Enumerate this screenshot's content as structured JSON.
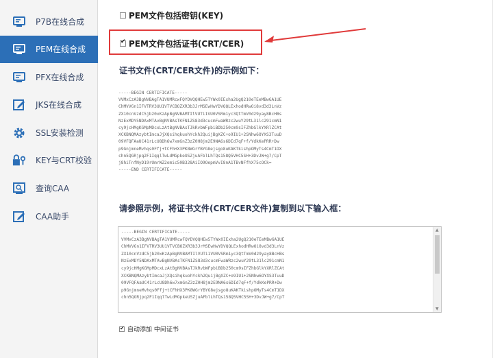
{
  "sidebar": {
    "items": [
      {
        "label": "P7B在线合成",
        "icon": "monitor-icon"
      },
      {
        "label": "PEM在线合成",
        "icon": "monitor-icon",
        "active": true
      },
      {
        "label": "PFX在线合成",
        "icon": "monitor-icon"
      },
      {
        "label": "JKS在线合成",
        "icon": "edit-icon"
      },
      {
        "label": "SSL安装检测",
        "icon": "gear-icon"
      },
      {
        "label": "KEY与CRT校验",
        "icon": "lock-icon"
      },
      {
        "label": "查询CAA",
        "icon": "search-icon"
      },
      {
        "label": "CAA助手",
        "icon": "edit-icon"
      }
    ]
  },
  "options": {
    "key_label": "PEM文件包括密钥(KEY)",
    "key_checked": false,
    "crt_label": "PEM文件包括证书(CRT/CER)",
    "crt_checked": true
  },
  "sample": {
    "title": "证书文件(CRT/CER文件)的示例如下：",
    "text": "-----BEGIN CERTIFICATE-----\nVVMxCzA3BgNVBAgTA1VUMRcwFQYDVQQHEw5TYWx0IExha2UgQ210eTEeMBwGA1UE\nChMVVGn1IFVTRV3UU1VTVCBOZXR3b3JrMSEwHwYDVQQLExhodHRwOi8vd3d3LnVz\nZX10cnVzdC5jb20xKzApBgNVBAMTIlVUTi1VU0VSRm1yc3QtTmV0d29yay8BcHBs\nNzExMDY5NDAxMTAvBgNVBAsTKFN1ZS83d3cucmFwaWRzc2wuY29tL31lc291cmN1\ncy9jcHMgKGMpMDcxLzAtBgNVBAsTJkRvbWFpbiBDb250cm9sIFZhbGlkYXRlZCAt\nXCKBNQMAzybtImcaJjXQsihqkuohYckh2QuijBgXZC+o9IU1+2SNhw6OYXS3TuuD\n09VFQFAaUC41rLcU8Dh6w7xmGnZ3zZ0H8jm2E9NA6s6DId7qF+f/YdkKePRR+Dw\np9GnjmneMvhqs0Ffj+tCFhHX3PK8WGrYBYG8ejsgo8uKAKTkishpOMyTs4CmT1DX\nchn5QGRjpq2F1IqqlTwLdMGpkeUSZjuAFblLhTQs158Q5VHC5SH+3DvJW+g7/CpT\nj8hiTnfNyD19rUmrWZ2omic50B328AiIO9OepmVvI8nA1TBvNFfhX75cOCk=\n-----END CERTIFICATE-----"
  },
  "input": {
    "title": "请参照示例，将证书文件(CRT/CER文件)复制到以下输入框：",
    "value": "-----BEGIN CERTIFICATE-----\nVVMxCzA3BgNVBAgTA1VUMRcwFQYDVQQHEw5TYWx0IExha2UgQ210eTEeMBwGA1UE\nChMVVGn1IFVTRV3UU1VTVCBOZXR3b3JrMSEwHwYDVQQLExhodHRwOi8vd3d3LnVz\nZX10cnVzdC5jb20xKzApBgNVBAMTIlVUTi1VU0VSRm1yc3QtTmV0d29yay8BcHBs\nNzExMDY5NDAxMTAvBgNVBAsTKFN1ZS83d3cucmFwaWRzc2wuY29tL31lc291cmN1\ncy9jcHMgKGMpMDcxLzAtBgNVBAsTJkRvbWFpbiBDb250cm9sIFZhbGlkYXRlZCAt\nXCKBNQMAzybtImcaJjXQsihqkuohYckh2QuijBgXZC+o9IU1+2SNhw6OYXS3TuuD\n09VFQFAaUC41rLcU8Dh6w7xmGnZ3zZ0H8jm2E9NA6s6DId7qF+f/YdkKePRR+Dw\np9GnjmneMvhqs0Ffj+tCFhHX3PK8WGrYBYG8ejsgo8uKAKTkishpOMyTs4CmT1DX\nchn5QGRjpq2F1IqqlTwLdMGpkeUSZjuAFblLhTQs158Q5VHC5SH+3DvJW+g7/CpT"
  },
  "auto_add": {
    "label": "自动添加 中间证书",
    "checked": true
  },
  "colors": {
    "accent": "#2c6fb7",
    "highlight": "#e03a3a"
  }
}
